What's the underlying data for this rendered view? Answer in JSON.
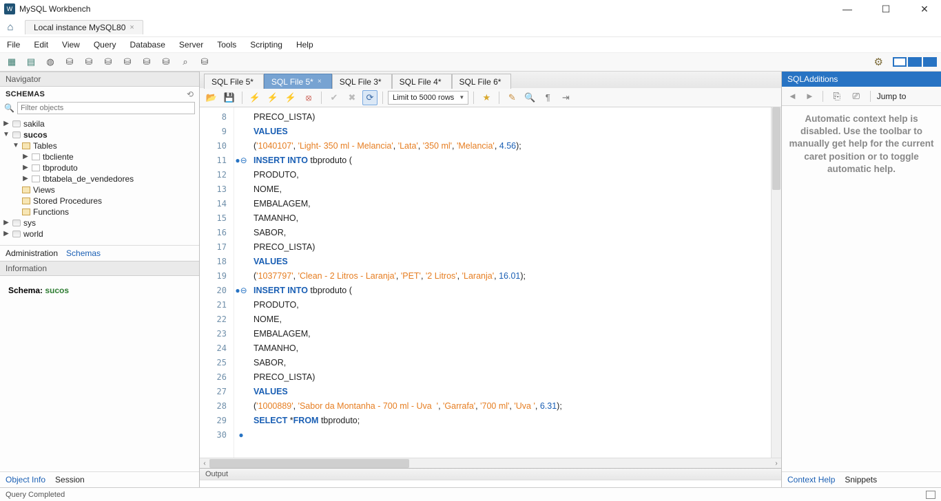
{
  "window": {
    "title": "MySQL Workbench"
  },
  "connectionTab": {
    "label": "Local instance MySQL80"
  },
  "menu": [
    "File",
    "Edit",
    "View",
    "Query",
    "Database",
    "Server",
    "Tools",
    "Scripting",
    "Help"
  ],
  "navigator": {
    "title": "Navigator",
    "schemasLabel": "SCHEMAS",
    "filterPlaceholder": "Filter objects",
    "bottomTabs": {
      "admin": "Administration",
      "schemas": "Schemas"
    }
  },
  "tree": {
    "sakila": "sakila",
    "sucos": "sucos",
    "tables": "Tables",
    "tbcliente": "tbcliente",
    "tbproduto": "tbproduto",
    "tbtabela": "tbtabela_de_vendedores",
    "views": "Views",
    "sp": "Stored Procedures",
    "func": "Functions",
    "sys": "sys",
    "world": "world"
  },
  "information": {
    "title": "Information",
    "schemaLabel": "Schema:",
    "schemaValue": "sucos",
    "tabs": {
      "obj": "Object Info",
      "session": "Session"
    }
  },
  "sqlTabs": [
    "SQL File 5*",
    "SQL File 5*",
    "SQL File 3*",
    "SQL File 4*",
    "SQL File 6*"
  ],
  "activeSqlTab": 1,
  "sqlToolbar": {
    "limitLabel": "Limit to 5000 rows"
  },
  "code": {
    "lines": [
      {
        "n": 8,
        "mark": "",
        "html": "PRECO_LISTA)"
      },
      {
        "n": 9,
        "mark": "",
        "html": "<span class='kw'>VALUES</span>"
      },
      {
        "n": 10,
        "mark": "",
        "html": "(<span class='str'>'1040107'</span>, <span class='str'>'Light- 350 ml - Melancia'</span>, <span class='str'>'Lata'</span>, <span class='str'>'350 ml'</span>, <span class='str'>'Melancia'</span>, <span class='num'>4.56</span>);"
      },
      {
        "n": 11,
        "mark": "●⊖",
        "html": "<span class='kw'>INSERT INTO</span> tbproduto ("
      },
      {
        "n": 12,
        "mark": "",
        "html": "PRODUTO,"
      },
      {
        "n": 13,
        "mark": "",
        "html": "NOME,"
      },
      {
        "n": 14,
        "mark": "",
        "html": "EMBALAGEM,"
      },
      {
        "n": 15,
        "mark": "",
        "html": "TAMANHO,"
      },
      {
        "n": 16,
        "mark": "",
        "html": "SABOR,"
      },
      {
        "n": 17,
        "mark": "",
        "html": "PRECO_LISTA)"
      },
      {
        "n": 18,
        "mark": "",
        "html": "<span class='kw'>VALUES</span>"
      },
      {
        "n": 19,
        "mark": "",
        "html": "(<span class='str'>'1037797'</span>, <span class='str'>'Clean - 2 Litros - Laranja'</span>, <span class='str'>'PET'</span>, <span class='str'>'2 Litros'</span>, <span class='str'>'Laranja'</span>, <span class='num'>16.01</span>);"
      },
      {
        "n": 20,
        "mark": "●⊖",
        "html": "<span class='kw'>INSERT INTO</span> tbproduto ("
      },
      {
        "n": 21,
        "mark": "",
        "html": "PRODUTO,"
      },
      {
        "n": 22,
        "mark": "",
        "html": "NOME,"
      },
      {
        "n": 23,
        "mark": "",
        "html": "EMBALAGEM,"
      },
      {
        "n": 24,
        "mark": "",
        "html": "TAMANHO,"
      },
      {
        "n": 25,
        "mark": "",
        "html": "SABOR,"
      },
      {
        "n": 26,
        "mark": "",
        "html": "PRECO_LISTA)"
      },
      {
        "n": 27,
        "mark": "",
        "html": "<span class='kw'>VALUES</span>"
      },
      {
        "n": 28,
        "mark": "",
        "html": "(<span class='str'>'1000889'</span>, <span class='str'>'Sabor da Montanha - 700 ml - Uva  '</span>, <span class='str'>'Garrafa'</span>, <span class='str'>'700 ml'</span>, <span class='str'>'Uva '</span>, <span class='num'>6.31</span>);"
      },
      {
        "n": 29,
        "mark": "",
        "html": ""
      },
      {
        "n": 30,
        "mark": "●",
        "html": "<span class='kw'>SELECT</span> *<span class='kw'>FROM</span> tbproduto;"
      }
    ]
  },
  "output": {
    "title": "Output"
  },
  "sqlAdditions": {
    "title": "SQLAdditions",
    "jump": "Jump to",
    "body": "Automatic context help is disabled. Use the toolbar to manually get help for the current caret position or to toggle automatic help.",
    "tabs": {
      "ctx": "Context Help",
      "snip": "Snippets"
    }
  },
  "status": {
    "text": "Query Completed"
  }
}
